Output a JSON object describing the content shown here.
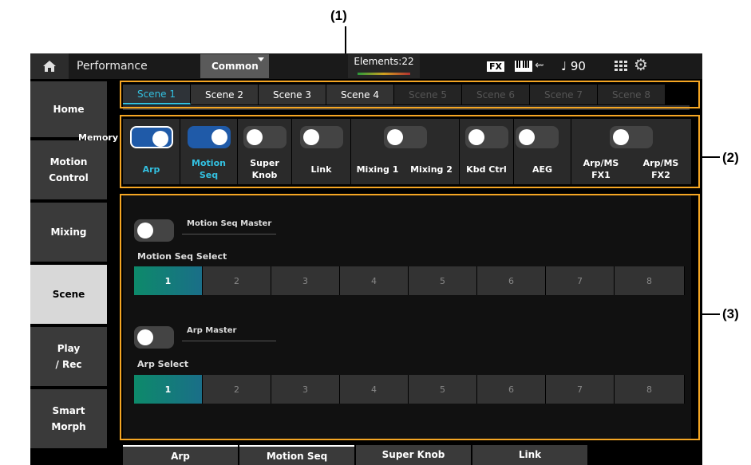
{
  "callouts": {
    "c1": "(1)",
    "c2": "(2)",
    "c3": "(3)"
  },
  "header": {
    "title": "Performance",
    "common_tab": "Common",
    "elements": "Elements:22",
    "fx_badge": "FX",
    "tempo": "♩ 90"
  },
  "sidebar": {
    "items": [
      {
        "label": "Home"
      },
      {
        "label": "Motion\nControl"
      },
      {
        "label": "Mixing"
      },
      {
        "label": "Scene"
      },
      {
        "label": "Play\n/ Rec"
      },
      {
        "label": "Smart\nMorph"
      }
    ]
  },
  "scenes": [
    "Scene 1",
    "Scene 2",
    "Scene 3",
    "Scene 4",
    "Scene 5",
    "Scene 6",
    "Scene 7",
    "Scene 8"
  ],
  "memory": {
    "label": "Memory",
    "items": [
      {
        "label": "Arp",
        "on": true
      },
      {
        "label": "Motion\nSeq",
        "on": true
      },
      {
        "label": "Super\nKnob",
        "on": false
      },
      {
        "label": "Link",
        "on": false
      },
      {
        "label": "Mixing 1",
        "on": false
      },
      {
        "label": "Mixing 2",
        "on": false
      },
      {
        "label": "Kbd Ctrl",
        "on": false
      },
      {
        "label": "AEG",
        "on": false
      },
      {
        "label": "Arp/MS\nFX1",
        "on": false
      },
      {
        "label": "Arp/MS\nFX2",
        "on": false
      }
    ]
  },
  "motion_seq": {
    "master_label": "Motion Seq Master",
    "select_label": "Motion Seq Select",
    "options": [
      "1",
      "2",
      "3",
      "4",
      "5",
      "6",
      "7",
      "8"
    ],
    "selected": "1"
  },
  "arp": {
    "master_label": "Arp Master",
    "select_label": "Arp Select",
    "options": [
      "1",
      "2",
      "3",
      "4",
      "5",
      "6",
      "7",
      "8"
    ],
    "selected": "1"
  },
  "bottom_tabs": [
    "Arp",
    "Motion Seq",
    "Super Knob",
    "Link"
  ],
  "colors": {
    "accent": "#33c0e0",
    "toggle_on": "#1f5aa8",
    "highlight": "#f5a623",
    "select_active": "#0d8a6a"
  }
}
